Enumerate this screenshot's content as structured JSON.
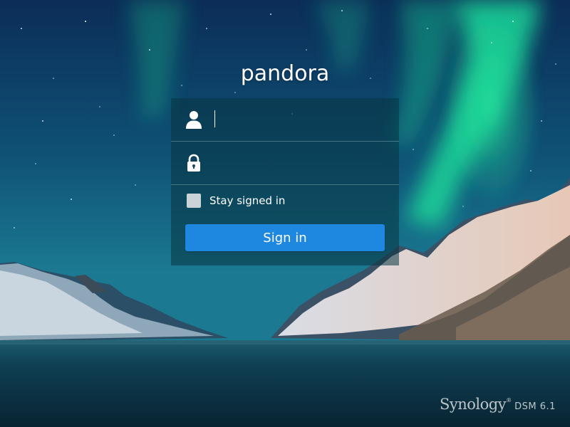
{
  "page": {
    "hostname": "pandora",
    "background": "aurora-borealis-fjord-mountains-wallpaper"
  },
  "login": {
    "username": {
      "value": "",
      "placeholder": "",
      "icon": "user-icon"
    },
    "password": {
      "value": "",
      "placeholder": "",
      "icon": "lock-icon"
    },
    "remember_label": "Stay signed in",
    "remember_checked": false,
    "submit_label": "Sign in"
  },
  "brand": {
    "logo_text": "Synology",
    "registered_mark": "®",
    "product": "DSM 6.1"
  },
  "colors": {
    "panel": "#083442",
    "button": "#1e88e0",
    "sky_top": "#0c2f57",
    "aurora": "#18d095",
    "water": "#0d3848",
    "text": "#ffffff"
  }
}
